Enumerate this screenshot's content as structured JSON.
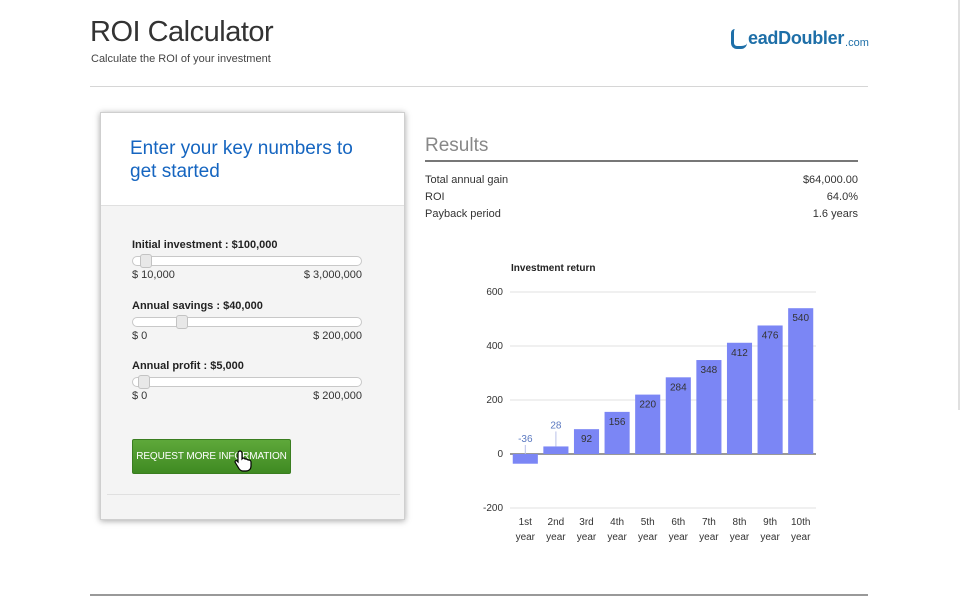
{
  "header": {
    "title": "ROI Calculator",
    "subtitle": "Calculate the ROI of your investment",
    "logo_text": "eadDoubler",
    "logo_suffix": ".com"
  },
  "inputs": {
    "heading": "Enter your key numbers to get started",
    "fields": [
      {
        "label": "Initial investment : $100,000",
        "min": "$ 10,000",
        "max": "$ 3,000,000",
        "value": 100000,
        "min_value": 10000,
        "max_value": 3000000
      },
      {
        "label": "Annual savings : $40,000",
        "min": "$ 0",
        "max": "$ 200,000",
        "value": 40000,
        "min_value": 0,
        "max_value": 200000
      },
      {
        "label": "Annual profit : $5,000",
        "min": "$ 0",
        "max": "$ 200,000",
        "value": 5000,
        "min_value": 0,
        "max_value": 200000
      }
    ],
    "cta_label": "Request more information"
  },
  "results": {
    "title": "Results",
    "rows": [
      {
        "label": "Total annual gain",
        "value": "$64,000.00"
      },
      {
        "label": "ROI",
        "value": "64.0%"
      },
      {
        "label": "Payback period",
        "value": "1.6 years"
      }
    ]
  },
  "colors": {
    "bar": "#7b86f5",
    "bar_negative": "#7b86f5",
    "label_negative": "#5a78c0"
  },
  "chart_data": {
    "type": "bar",
    "title": "Investment return",
    "categories": [
      "1st year",
      "2nd year",
      "3rd year",
      "4th year",
      "5th year",
      "6th year",
      "7th year",
      "8th year",
      "9th year",
      "10th year"
    ],
    "values": [
      -36,
      28,
      92,
      156,
      220,
      284,
      348,
      412,
      476,
      540
    ],
    "ylim": [
      -200,
      600
    ],
    "yticks": [
      -200,
      0,
      200,
      400,
      600
    ],
    "grid": true
  }
}
